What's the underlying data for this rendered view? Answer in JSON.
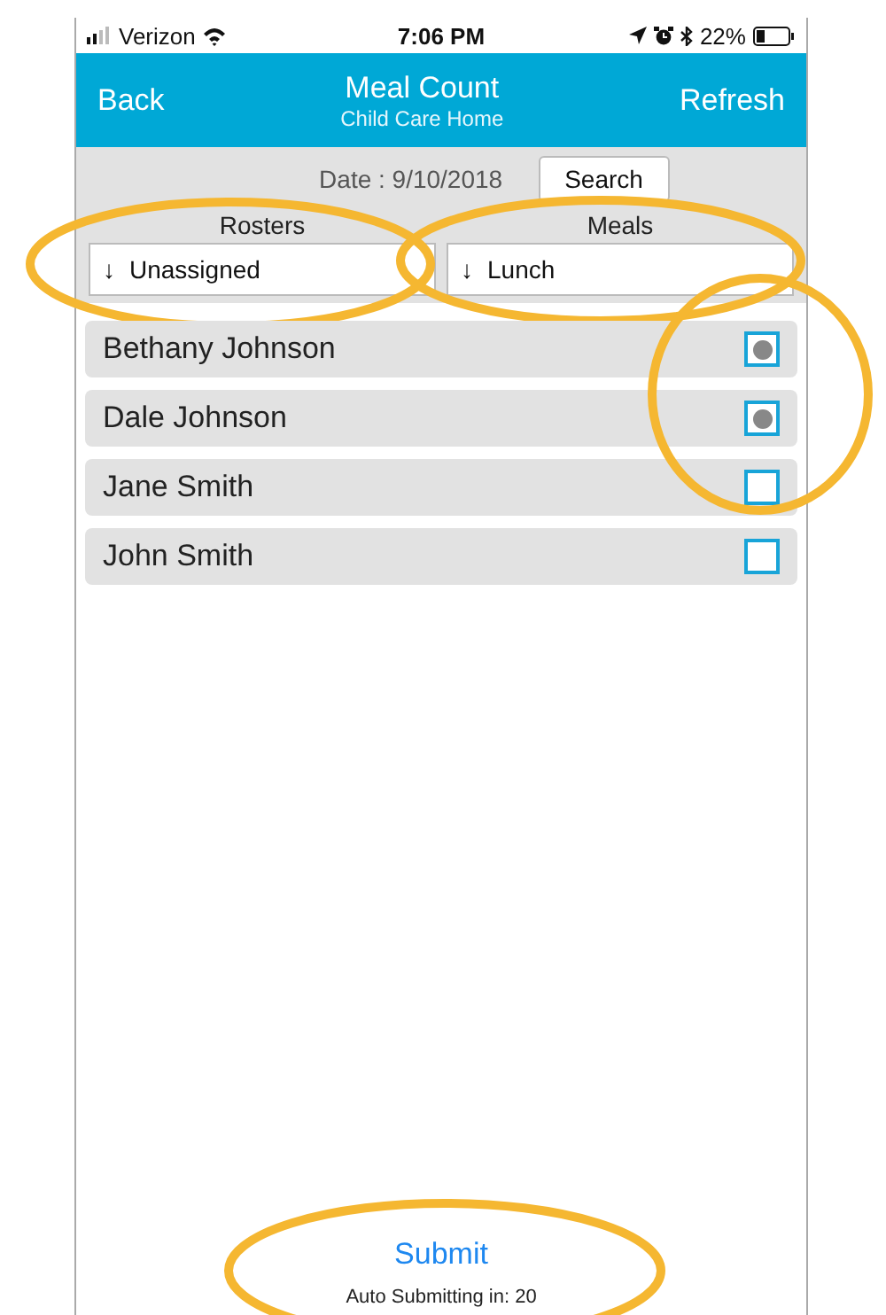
{
  "status_bar": {
    "carrier": "Verizon",
    "time": "7:06 PM",
    "battery": "22%"
  },
  "nav": {
    "back": "Back",
    "title": "Meal Count",
    "subtitle": "Child Care Home",
    "refresh": "Refresh"
  },
  "filter": {
    "date": "Date : 9/10/2018",
    "search": "Search",
    "selects": [
      {
        "label": "Rosters",
        "arrow": "↓",
        "value": "Unassigned",
        "circled": true
      },
      {
        "label": "Meals",
        "arrow": "↓",
        "value": "Lunch",
        "circled": true
      }
    ]
  },
  "list": {
    "checkboxes_circled": true,
    "rows": [
      {
        "name": "Bethany Johnson",
        "checked": true
      },
      {
        "name": "Dale Johnson",
        "checked": true
      },
      {
        "name": "Jane Smith",
        "checked": false
      },
      {
        "name": "John Smith",
        "checked": false
      }
    ]
  },
  "footer": {
    "submit": "Submit",
    "note": "Auto Submitting in: 20",
    "circled": true
  }
}
